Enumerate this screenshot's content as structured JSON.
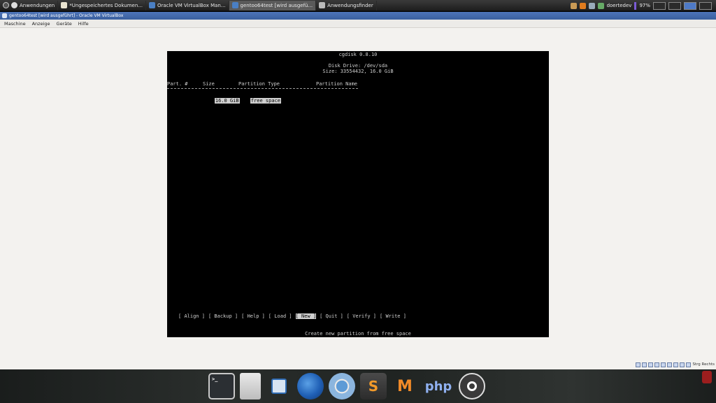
{
  "taskbar": {
    "apps_menu": "Anwendungen",
    "tasks": [
      {
        "label": "*Ungespeichertes Dokumen...",
        "icon": "text-editor-icon",
        "active": false
      },
      {
        "label": "Oracle VM VirtualBox Man...",
        "icon": "virtualbox-icon",
        "active": false
      },
      {
        "label": "gentoo64test [wird ausgefü...",
        "icon": "virtualbox-icon",
        "active": true
      },
      {
        "label": "Anwendungsfinder",
        "icon": "app-finder-icon",
        "active": false
      }
    ],
    "user": "doertedev",
    "battery": "97%"
  },
  "window": {
    "title": "gentoo64test [wird ausgeführt] - Oracle VM VirtualBox",
    "menu": [
      "Maschine",
      "Anzeige",
      "Geräte",
      "Hilfe"
    ],
    "host_key": "Strg Rechts"
  },
  "cgdisk": {
    "title": "cgdisk 0.8.10",
    "drive": "Disk Drive: /dev/sda",
    "size": "Size: 33554432, 16.0 GiB",
    "columns": {
      "part": "Part. #",
      "size": "Size",
      "type": "Partition Type",
      "name": "Partition Name"
    },
    "row": {
      "size": "16.0 GiB",
      "type": "free space"
    },
    "menu": [
      {
        "label": "Align",
        "selected": false
      },
      {
        "label": "Backup",
        "selected": false
      },
      {
        "label": "Help",
        "selected": false
      },
      {
        "label": "Load",
        "selected": false
      },
      {
        "label": " New ",
        "selected": true
      },
      {
        "label": "Quit",
        "selected": false
      },
      {
        "label": "Verify",
        "selected": false
      },
      {
        "label": "Write",
        "selected": false
      }
    ],
    "help_text": "Create new partition from free space"
  },
  "dock": {
    "terminal_prompt": ">_",
    "items": [
      "terminal-icon",
      "file-manager-icon",
      "virtualbox-icon",
      "firefox-icon",
      "chromium-icon",
      "sublime-text-icon",
      "mr-icon",
      "phpstorm-icon",
      "network-icon"
    ],
    "sublime_glyph": "S",
    "mr_glyph": "M",
    "php_glyph": "php"
  }
}
